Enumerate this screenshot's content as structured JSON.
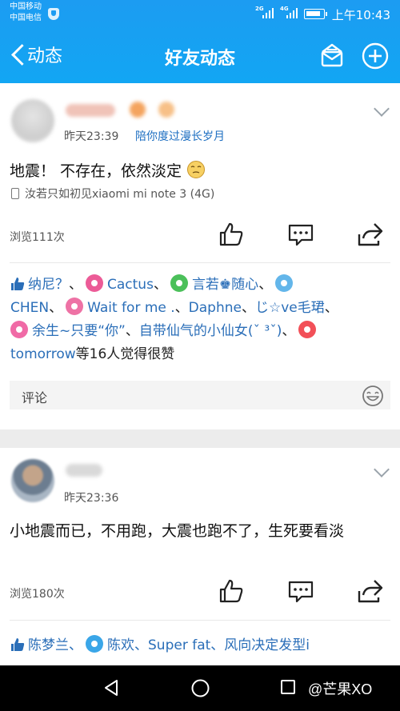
{
  "status_bar": {
    "carrier_1": "中国移动",
    "carrier_2": "中国电信",
    "signal_1": "2G",
    "signal_2": "4G",
    "time": "上午10:43"
  },
  "nav": {
    "back_label": "动态",
    "title": "好友动态",
    "icons": [
      "mail-icon",
      "plus-icon"
    ]
  },
  "posts": [
    {
      "time": "昨天23:39",
      "tag": "陪你度过漫长岁月",
      "text": "地震！ 不存在，依然淡定",
      "emoji": "smile-emoji",
      "device": "汝若只如初见xiaomi mi note 3 (4G)",
      "views": "浏览111次",
      "likes": {
        "users": [
          "纳尼？",
          "Cactus",
          "言若♚随心",
          "CHEN",
          "Wait for me .",
          "Daphne",
          "じ☆ve毛珺",
          "余生~只要“你”",
          "自带仙气的小仙女(ˇ ³ˇ)",
          "tomorrow"
        ],
        "suffix": "等16人觉得很赞"
      },
      "comment_placeholder": "评论"
    },
    {
      "time": "昨天23:36",
      "text": "小地震而已，不用跑，大震也跑不了，生死要看淡",
      "views": "浏览180次",
      "likes": {
        "users": [
          "陈梦兰",
          "陈欢",
          "Super fat",
          "风向决定发型i"
        ]
      }
    }
  ],
  "watermark": "@芒果XO",
  "colors": {
    "header_blue": "#1c9cf2",
    "link_blue": "#2a6eb8",
    "tag_blue": "#1e6fc2"
  }
}
